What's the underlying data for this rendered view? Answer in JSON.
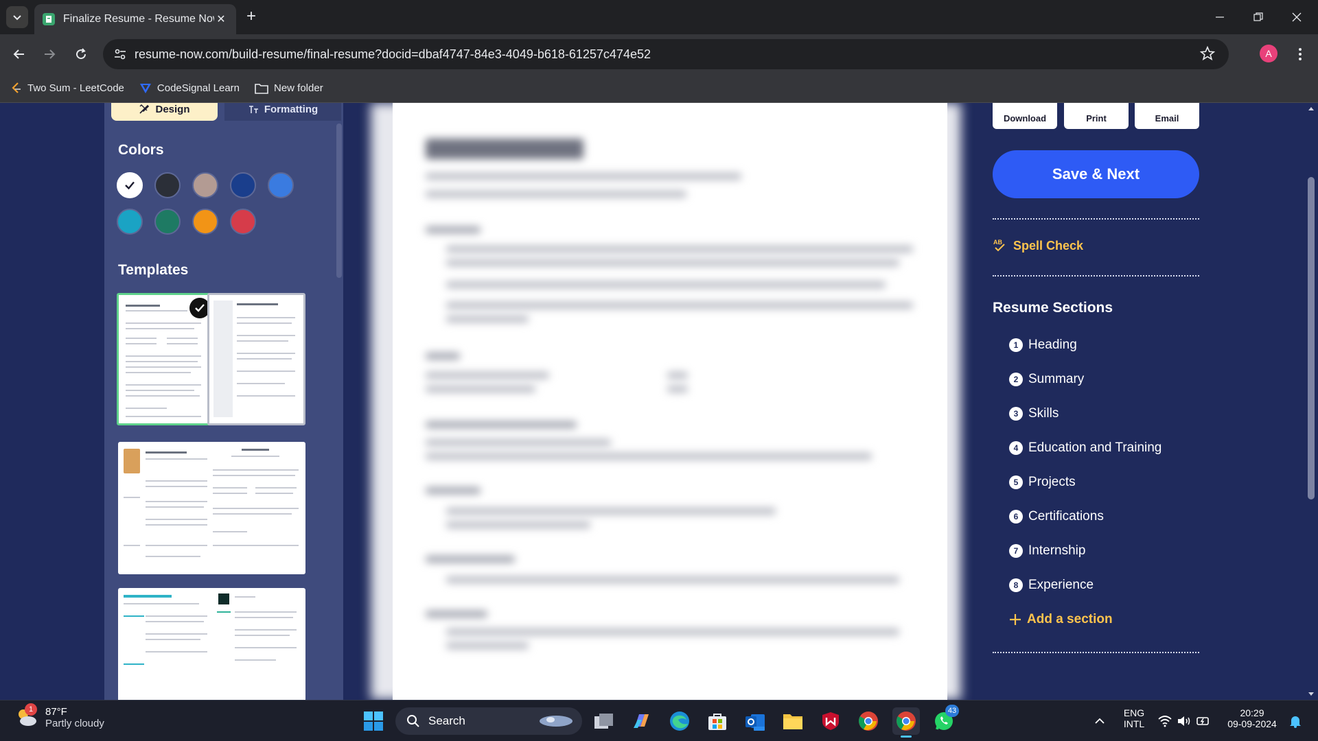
{
  "browser": {
    "tab_title": "Finalize Resume - Resume Now",
    "url": "resume-now.com/build-resume/final-resume?docid=dbaf4747-84e3-4049-b618-61257c474e52",
    "profile_initial": "A",
    "bookmarks": [
      {
        "label": "Two Sum - LeetCode",
        "icon": "leetcode-icon"
      },
      {
        "label": "CodeSignal Learn",
        "icon": "codesignal-icon"
      },
      {
        "label": "New folder",
        "icon": "folder-icon"
      }
    ]
  },
  "left_panel": {
    "tabs": {
      "design": "Design",
      "formatting": "Formatting"
    },
    "colors_title": "Colors",
    "colors": [
      "#ffffff",
      "#2b2f38",
      "#b39b93",
      "#1a3e8c",
      "#3a7be0",
      "#1aa3c4",
      "#1e7a63",
      "#f29416",
      "#d63c4a"
    ],
    "selected_color_index": 0,
    "templates_title": "Templates"
  },
  "right_panel": {
    "actions": {
      "download": "Download",
      "print": "Print",
      "email": "Email"
    },
    "save_next": "Save & Next",
    "spell_check": "Spell Check",
    "spell_badge": "AB",
    "sections_title": "Resume Sections",
    "sections": [
      {
        "num": "1",
        "label": "Heading"
      },
      {
        "num": "2",
        "label": "Summary"
      },
      {
        "num": "3",
        "label": "Skills"
      },
      {
        "num": "4",
        "label": "Education and Training"
      },
      {
        "num": "5",
        "label": "Projects"
      },
      {
        "num": "6",
        "label": "Certifications"
      },
      {
        "num": "7",
        "label": "Internship"
      },
      {
        "num": "8",
        "label": "Experience"
      }
    ],
    "add_section": "Add a section"
  },
  "taskbar": {
    "weather_temp": "87°F",
    "weather_desc": "Partly cloudy",
    "weather_badge": "1",
    "search_label": "Search",
    "whatsapp_badge": "43",
    "lang_top": "ENG",
    "lang_bottom": "INTL",
    "time": "20:29",
    "date": "09-09-2024"
  }
}
